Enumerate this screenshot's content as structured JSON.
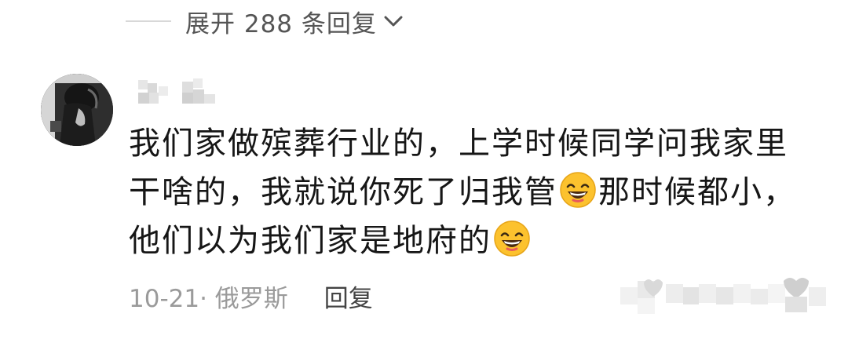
{
  "replies": {
    "expand_label": "展开 288 条回复"
  },
  "comment": {
    "text_parts": [
      "我们家做殡葬行业的，上学时候同学问我家里干啥的，我就说你死了归我管",
      "那时候都小，他们以为我们家是地府的"
    ],
    "emoji_name": "grinning-sweat-smile-emoji",
    "meta": {
      "date_location": "10-21· 俄罗斯",
      "reply_label": "回复"
    }
  },
  "icons": {
    "expand": "chevron-down-icon",
    "like": "heart-icon",
    "dislike": "heart-icon"
  },
  "colors": {
    "text_primary": "#161616",
    "text_secondary": "#9a9a9a",
    "emoji_face": "#fcc22e"
  }
}
